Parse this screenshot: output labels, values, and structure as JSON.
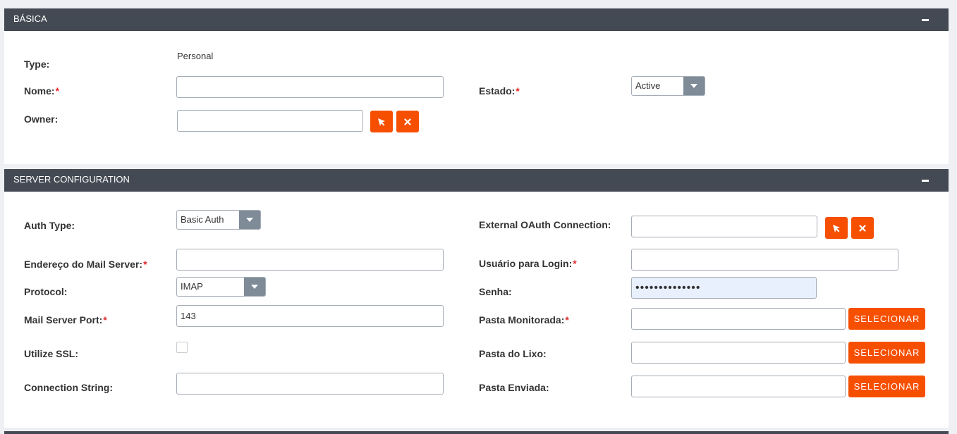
{
  "basic": {
    "title": "BÁSICA",
    "type_label": "Type:",
    "type_value": "Personal",
    "name_label": "Nome:",
    "name_value": "",
    "state_label": "Estado:",
    "state_value": "Active",
    "owner_label": "Owner:",
    "owner_value": "",
    "required_mark": "*"
  },
  "server": {
    "title": "SERVER CONFIGURATION",
    "auth_type_label": "Auth Type:",
    "auth_type_value": "Basic Auth",
    "oauth_label": "External OAuth Connection:",
    "oauth_value": "",
    "mail_server_label": "Endereço do Mail Server:",
    "mail_server_value": "",
    "login_label": "Usuário para Login:",
    "login_value": "",
    "protocol_label": "Protocol:",
    "protocol_value": "IMAP",
    "password_label": "Senha:",
    "password_value": "••••••••••••••",
    "port_label": "Mail Server Port:",
    "port_value": "143",
    "monitored_folder_label": "Pasta Monitorada:",
    "monitored_folder_value": "",
    "ssl_label": "Utilize SSL:",
    "ssl_checked": false,
    "trash_folder_label": "Pasta do Lixo:",
    "trash_folder_value": "",
    "connection_string_label": "Connection String:",
    "connection_string_value": "",
    "sent_folder_label": "Pasta Enviada:",
    "sent_folder_value": "",
    "select_button_label": "SELECIONAR",
    "required_mark": "*"
  },
  "colors": {
    "header_bg": "#434a53",
    "accent_orange": "#f74f00",
    "required_red": "#e02a2a",
    "select_arrow_bg": "#7f8b97",
    "autofill_bg": "#e8f0fe"
  },
  "icons": {
    "select": "cursor-arrow-icon",
    "clear": "close-x-icon",
    "collapse": "minus-icon",
    "dropdown": "caret-down-icon"
  }
}
